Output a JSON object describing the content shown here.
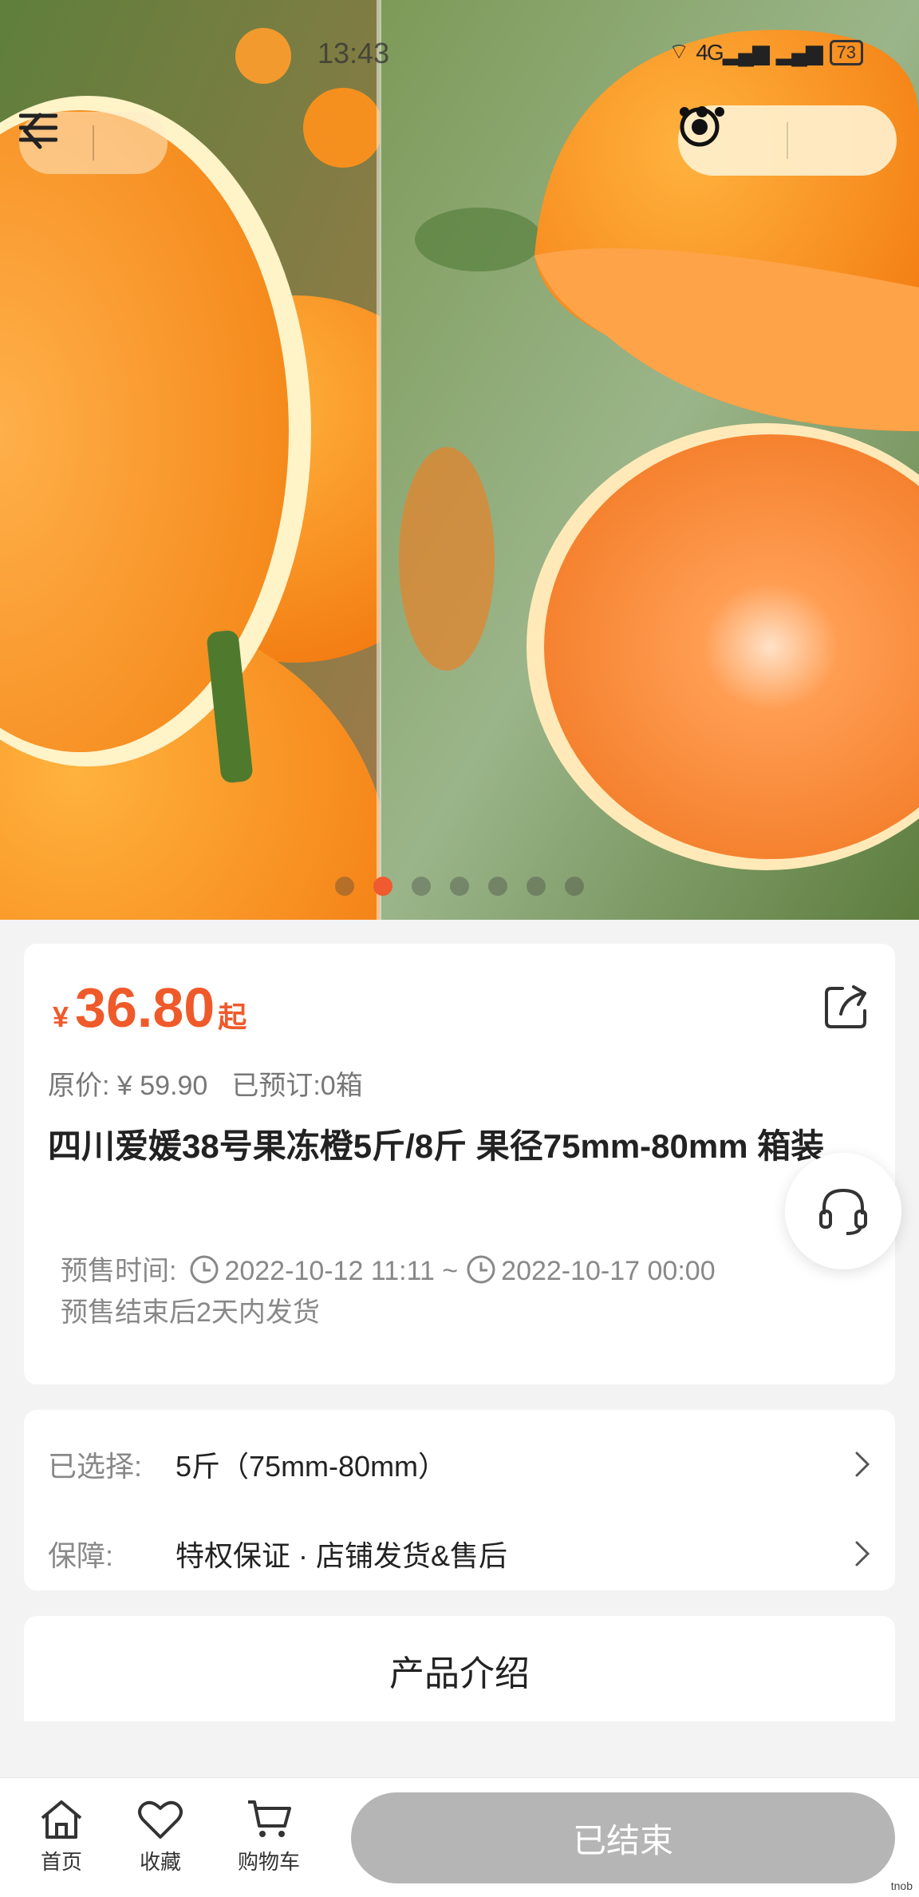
{
  "status_bar": {
    "time": "13:43",
    "network": "4G",
    "battery": "73"
  },
  "nav": {
    "back_icon": "chevron-left-icon",
    "menu_icon": "hamburger-icon",
    "more_icon": "more-dots-icon",
    "close_icon": "target-icon"
  },
  "carousel": {
    "total": 7,
    "active_index": 1
  },
  "product": {
    "currency": "¥",
    "price": "36.80",
    "price_suffix": "起",
    "original_price": "原价: ¥ 59.90",
    "preordered": "已预订:0箱",
    "title": "四川爱媛38号果冻橙5斤/8斤 果径75mm-80mm 箱装",
    "presale_label": "预售时间:",
    "presale_start": "2022-10-12 11:11 ~",
    "presale_end": "2022-10-17 00:00",
    "shipping_note": "预售结束后2天内发货"
  },
  "options": {
    "selected_label": "已选择:",
    "selected_value": "5斤（75mm-80mm）",
    "guarantee_label": "保障:",
    "guarantee_value": "特权保证 · 店铺发货&售后"
  },
  "intro": {
    "title": "产品介绍"
  },
  "bottom_bar": {
    "home_label": "首页",
    "favorite_label": "收藏",
    "cart_label": "购物车",
    "status_button": "已结束"
  },
  "colors": {
    "accent": "#ef5a2b",
    "disabled": "#b5b5b5"
  },
  "watermark": "tnob"
}
